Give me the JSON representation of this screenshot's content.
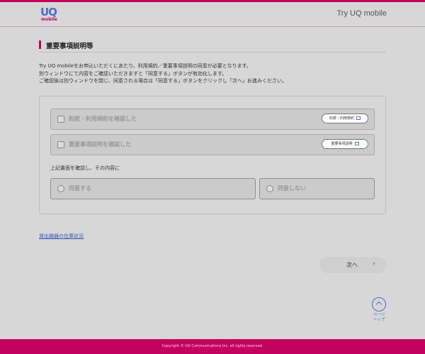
{
  "colors": {
    "brand": "#c4005e",
    "accent": "#4a6dc4",
    "background": "#d7d7d7"
  },
  "header": {
    "logo_text": "UQ",
    "logo_sub": "mobile",
    "right_title": "Try UQ mobile"
  },
  "section": {
    "title": "重要事項説明等",
    "intro_lines": [
      "Try UQ mobileをお申込いただくにあたり、利用規約／重要事項説明の同意が必要となります。",
      "別ウィンドウにて内容をご確認いただきますと「同意する」ボタンが有効化します。",
      "ご確認後は別ウィンドウを閉じ、同意される場合は「同意する」ボタンをクリックし「次へ」お進みください。"
    ]
  },
  "checks": [
    {
      "label": "約款・利用規約を確認した",
      "link_label": "約款・利用規約",
      "icon": "external-link-icon"
    },
    {
      "label": "重要事項説明を確認した",
      "link_label": "重要事項説明",
      "icon": "external-link-icon"
    }
  ],
  "agree": {
    "prompt": "上記書面を確認し、その内容に",
    "options": [
      "同意する",
      "同意しない"
    ]
  },
  "stock_link": "貸出機器の在庫状況",
  "next_button": {
    "label": "次へ",
    "icon": "chevron-right-icon"
  },
  "page_top": {
    "line1": "ページ",
    "line2": "トップ",
    "icon": "chevron-up-icon"
  },
  "footer": {
    "copyright": "Copyright © UQ Communications Inc. all rights reserved."
  }
}
